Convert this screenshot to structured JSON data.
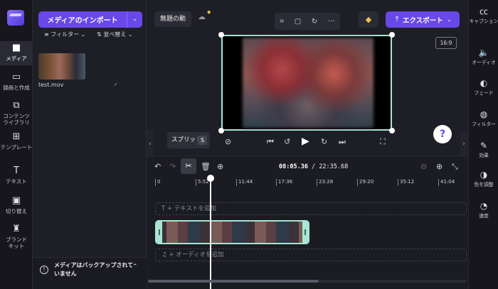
{
  "left_rail": {
    "items": [
      {
        "label": "メディア",
        "icon": "folder-icon"
      },
      {
        "label": "録画と作成",
        "icon": "video-camera-icon"
      },
      {
        "label": "コンテンツ ライブラリ",
        "icon": "content-library-icon"
      },
      {
        "label": "テンプレート",
        "icon": "templates-icon"
      },
      {
        "label": "テキスト",
        "icon": "text-icon"
      },
      {
        "label": "切り替え",
        "icon": "transitions-icon"
      },
      {
        "label": "ブランド キット",
        "icon": "brand-kit-icon"
      }
    ]
  },
  "media_panel": {
    "import_label": "メディアのインポート",
    "filter_label": "フィルター",
    "sort_label": "並べ替え",
    "file_name": "test.mov",
    "backup_text": "メディアはバックアップされていません"
  },
  "topbar": {
    "project_name": "無題の動",
    "export_label": "エクスポート",
    "aspect_ratio": "16:9"
  },
  "tooltip": {
    "label": "スプリット",
    "shortcut": "S"
  },
  "timeline": {
    "current_time": "08:05.36",
    "total_time": "22:35.68",
    "ruler_labels": [
      "0",
      "5:52",
      "11:44",
      "17:36",
      "23:28",
      "29:20",
      "35:12",
      "41:04"
    ],
    "text_track_placeholder": "+ テキストを追加",
    "audio_track_placeholder": "+ オーディオを追加"
  },
  "right_rail": {
    "items": [
      {
        "label": "キャプション",
        "icon": "captions-icon"
      },
      {
        "label": "オーディオ",
        "icon": "speaker-icon"
      },
      {
        "label": "フェード",
        "icon": "fade-icon"
      },
      {
        "label": "フィルター",
        "icon": "filters-icon"
      },
      {
        "label": "効果",
        "icon": "effects-icon"
      },
      {
        "label": "色を調整",
        "icon": "adjust-colors-icon"
      },
      {
        "label": "速度",
        "icon": "speed-icon"
      }
    ]
  },
  "colors": {
    "accent": "#6848e8",
    "selection": "#a7e6d3"
  }
}
